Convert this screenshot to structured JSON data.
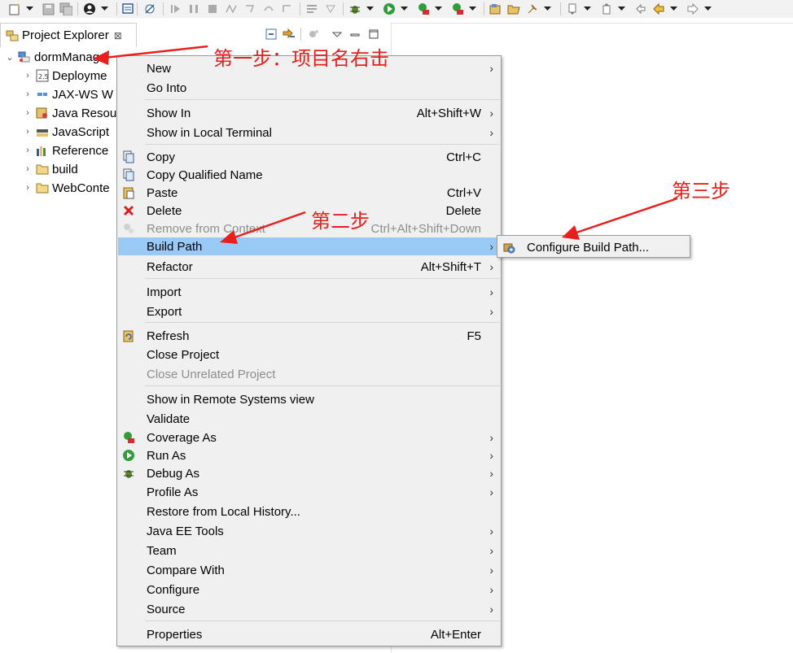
{
  "toolbar": {
    "icons": [
      "new-wizard-icon",
      "save-icon",
      "save-all-icon",
      "user-icon",
      "task-icon",
      "skip-breakpoints-icon",
      "resume-icon",
      "suspend-icon",
      "terminate-icon",
      "disconnect-icon",
      "step-into-icon",
      "step-over-icon",
      "step-return-icon",
      "drop-to-frame-icon",
      "use-step-filters-icon",
      "debug-icon",
      "run-icon",
      "coverage-icon",
      "external-tools-icon",
      "new-package-icon",
      "open-folder-icon",
      "pin-icon",
      "next-annotation-icon",
      "prev-annotation-icon",
      "last-edit-icon",
      "back-icon",
      "forward-icon"
    ]
  },
  "panel": {
    "title": "Project Explorer",
    "close_glyph": "⊠"
  },
  "tree": {
    "root": "dormManage",
    "children": [
      {
        "label": "Deployme",
        "icon": "deployment-descriptor-icon"
      },
      {
        "label": "JAX-WS W",
        "icon": "jax-ws-icon"
      },
      {
        "label": "Java Resou",
        "icon": "java-resources-icon"
      },
      {
        "label": "JavaScript",
        "icon": "javascript-resources-icon"
      },
      {
        "label": "Reference",
        "icon": "referenced-libraries-icon"
      },
      {
        "label": "build",
        "icon": "folder-icon"
      },
      {
        "label": "WebConte",
        "icon": "folder-icon"
      }
    ]
  },
  "context_menu": {
    "items": [
      {
        "label": "New",
        "shortcut": "",
        "submenu": true
      },
      {
        "label": "Go Into",
        "shortcut": "",
        "submenu": false
      },
      {
        "label": "Show In",
        "shortcut": "Alt+Shift+W",
        "submenu": true
      },
      {
        "label": "Show in Local Terminal",
        "shortcut": "",
        "submenu": true
      },
      {
        "label": "Copy",
        "shortcut": "Ctrl+C",
        "submenu": false,
        "icon": "copy-icon"
      },
      {
        "label": "Copy Qualified Name",
        "shortcut": "",
        "submenu": false,
        "icon": "copy-qualified-name-icon"
      },
      {
        "label": "Paste",
        "shortcut": "Ctrl+V",
        "submenu": false,
        "icon": "paste-icon"
      },
      {
        "label": "Delete",
        "shortcut": "Delete",
        "submenu": false,
        "icon": "delete-icon"
      },
      {
        "label": "Remove from Context",
        "shortcut": "Ctrl+Alt+Shift+Down",
        "submenu": false,
        "disabled": true,
        "icon": "remove-context-icon"
      },
      {
        "label": "Build Path",
        "shortcut": "",
        "submenu": true,
        "highlight": true
      },
      {
        "label": "Refactor",
        "shortcut": "Alt+Shift+T",
        "submenu": true
      },
      {
        "label": "Import",
        "shortcut": "",
        "submenu": true
      },
      {
        "label": "Export",
        "shortcut": "",
        "submenu": true
      },
      {
        "label": "Refresh",
        "shortcut": "F5",
        "submenu": false,
        "icon": "refresh-icon"
      },
      {
        "label": "Close Project",
        "shortcut": "",
        "submenu": false
      },
      {
        "label": "Close Unrelated Project",
        "shortcut": "",
        "submenu": false,
        "disabled": true
      },
      {
        "label": "Show in Remote Systems view",
        "shortcut": "",
        "submenu": false
      },
      {
        "label": "Validate",
        "shortcut": "",
        "submenu": false
      },
      {
        "label": "Coverage As",
        "shortcut": "",
        "submenu": true,
        "icon": "coverage-icon"
      },
      {
        "label": "Run As",
        "shortcut": "",
        "submenu": true,
        "icon": "run-icon"
      },
      {
        "label": "Debug As",
        "shortcut": "",
        "submenu": true,
        "icon": "debug-icon"
      },
      {
        "label": "Profile As",
        "shortcut": "",
        "submenu": true
      },
      {
        "label": "Restore from Local History...",
        "shortcut": "",
        "submenu": false
      },
      {
        "label": "Java EE Tools",
        "shortcut": "",
        "submenu": true
      },
      {
        "label": "Team",
        "shortcut": "",
        "submenu": true
      },
      {
        "label": "Compare With",
        "shortcut": "",
        "submenu": true
      },
      {
        "label": "Configure",
        "shortcut": "",
        "submenu": true
      },
      {
        "label": "Source",
        "shortcut": "",
        "submenu": true
      },
      {
        "label": "Properties",
        "shortcut": "Alt+Enter",
        "submenu": false
      }
    ],
    "arrow_glyph": "›"
  },
  "submenu": {
    "label": "Configure Build Path...",
    "icon": "configure-build-path-icon"
  },
  "annotations": {
    "step1": "第一步：项目名右击",
    "step2": "第二步",
    "step3": "第三步",
    "color": "#e8201d"
  },
  "colors": {
    "highlight": "#99c9f5",
    "menu_bg": "#f0f0f0",
    "disabled_text": "#8d8d8d"
  }
}
